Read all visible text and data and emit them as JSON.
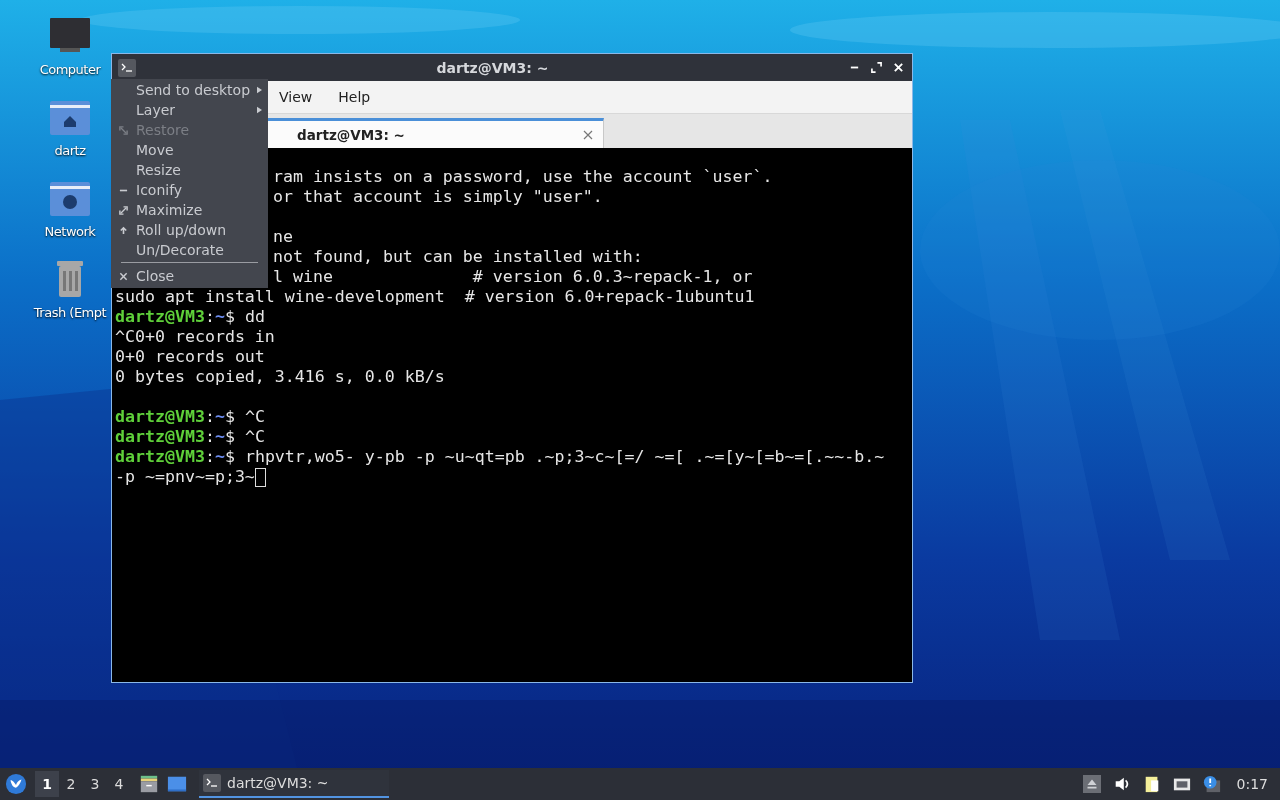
{
  "desktop_icons": [
    {
      "kind": "computer",
      "label": "Computer"
    },
    {
      "kind": "home",
      "label": "dartz"
    },
    {
      "kind": "network",
      "label": "Network"
    },
    {
      "kind": "trash",
      "label": "Trash (Empt"
    }
  ],
  "window": {
    "title": "dartz@VM3: ~",
    "menu_bar": [
      "View",
      "Help"
    ],
    "tabs": [
      {
        "label": "dartz@VM3: ~",
        "selected": true
      }
    ],
    "terminal": {
      "partial_lines": [
        {
          "kind": "text",
          "text": "ram insists on a password, use the account `user`."
        },
        {
          "kind": "text",
          "text": "or that account is simply \"user\"."
        },
        {
          "kind": "blank"
        },
        {
          "kind": "text",
          "text": "ne"
        },
        {
          "kind": "text",
          "text": "not found, but can be installed with:"
        },
        {
          "kind": "text",
          "text": "l wine              # version 6.0.3~repack-1, or"
        }
      ],
      "lines": [
        {
          "kind": "text",
          "text": "sudo apt install wine-development  # version 6.0+repack-1ubuntu1"
        },
        {
          "kind": "prompt",
          "user": "dartz@VM3",
          "sep": ":",
          "path": "~",
          "command": "$ dd"
        },
        {
          "kind": "text",
          "text": "^C0+0 records in"
        },
        {
          "kind": "text",
          "text": "0+0 records out"
        },
        {
          "kind": "text",
          "text": "0 bytes copied, 3.416 s, 0.0 kB/s"
        },
        {
          "kind": "blank"
        },
        {
          "kind": "prompt",
          "user": "dartz@VM3",
          "sep": ":",
          "path": "~",
          "command": "$ ^C"
        },
        {
          "kind": "prompt",
          "user": "dartz@VM3",
          "sep": ":",
          "path": "~",
          "command": "$ ^C"
        },
        {
          "kind": "prompt",
          "user": "dartz@VM3",
          "sep": ":",
          "path": "~",
          "command": "$ rhpvtr,wo5- y-pb -p ~u~qt=pb .~p;3~c~[=/ ~=[ .~=[y~[=b~=[.~~-b.~"
        },
        {
          "kind": "cursor",
          "text": "-p ~=pnv~=p;3~"
        }
      ]
    }
  },
  "window_menu": [
    {
      "kind": "item",
      "label": "Send to desktop",
      "submenu": true,
      "disabled": false
    },
    {
      "kind": "item",
      "label": "Layer",
      "submenu": true,
      "disabled": false
    },
    {
      "kind": "item",
      "label": "Restore",
      "submenu": false,
      "disabled": true
    },
    {
      "kind": "item",
      "label": "Move",
      "submenu": false,
      "disabled": false
    },
    {
      "kind": "item",
      "label": "Resize",
      "submenu": false,
      "disabled": false
    },
    {
      "kind": "item",
      "label": "Iconify",
      "submenu": false,
      "disabled": false
    },
    {
      "kind": "item",
      "label": "Maximize",
      "submenu": false,
      "disabled": false
    },
    {
      "kind": "item",
      "label": "Roll up/down",
      "submenu": false,
      "disabled": false
    },
    {
      "kind": "item",
      "label": "Un/Decorate",
      "submenu": false,
      "disabled": false
    },
    {
      "kind": "separator"
    },
    {
      "kind": "item",
      "label": "Close",
      "submenu": false,
      "disabled": false
    }
  ],
  "taskbar": {
    "workspaces": [
      {
        "label": "1",
        "selected": true
      },
      {
        "label": "2",
        "selected": false
      },
      {
        "label": "3",
        "selected": false
      },
      {
        "label": "4",
        "selected": false
      }
    ],
    "tasks": [
      {
        "label": "dartz@VM3: ~",
        "selected": true
      }
    ],
    "clock": "0:17"
  }
}
